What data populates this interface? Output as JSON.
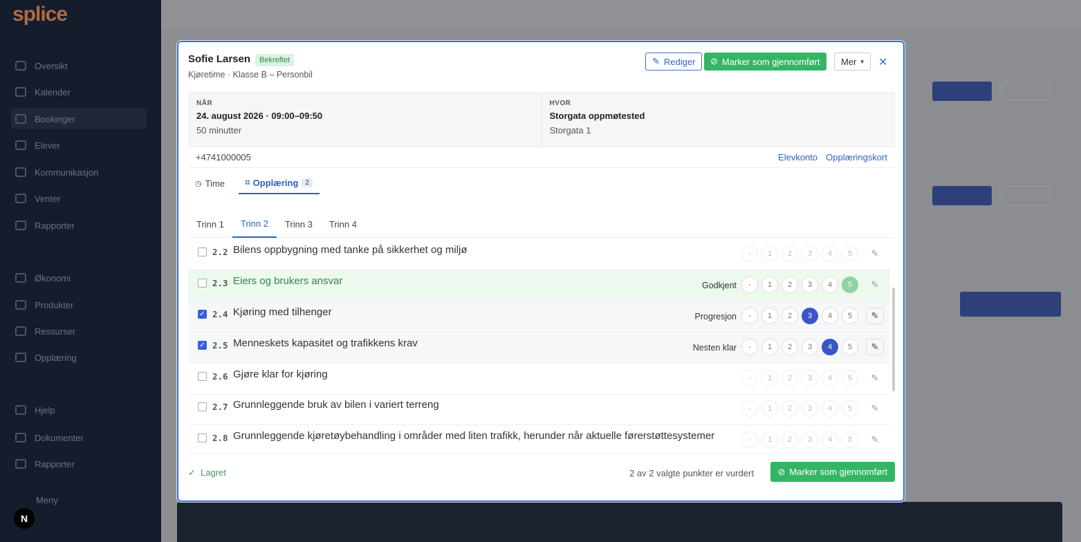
{
  "app": {
    "logo": "splice"
  },
  "sidebar": {
    "items": [
      {
        "label": "Oversikt"
      },
      {
        "label": "Kalender"
      },
      {
        "label": "Bookinger"
      },
      {
        "label": "Elever"
      },
      {
        "label": "Kommunikasjon"
      },
      {
        "label": "Venter"
      },
      {
        "label": "Rapporter"
      },
      {
        "label": "Økonomi"
      },
      {
        "label": "Produkter"
      },
      {
        "label": "Ressurser"
      },
      {
        "label": "Opplæring"
      },
      {
        "label": "Hjelp"
      },
      {
        "label": "Dokumenter"
      },
      {
        "label": "Rapporter"
      },
      {
        "label": "Meny"
      }
    ]
  },
  "modal": {
    "student_name": "Sofie Larsen",
    "status_badge": "Bekreftet",
    "subtitle": "Kjøretime · Klasse B – Personbil",
    "buttons": {
      "edit": "Rediger",
      "mark_done": "Marker som gjennomført",
      "more": "Mer"
    },
    "when": {
      "label": "NÅR",
      "value": "24. august 2026 · 09:00–09:50",
      "duration": "50 minutter"
    },
    "where": {
      "label": "HVOR",
      "value": "Storgata oppmøtested",
      "address": "Storgata 1"
    },
    "phone": "+4741000005",
    "links": {
      "account": "Elevkonto",
      "training_card": "Opplæringskort"
    },
    "tabs": [
      {
        "label": "Time"
      },
      {
        "label": "Opplæring",
        "count": "2"
      }
    ],
    "steps": [
      "Trinn 1",
      "Trinn 2",
      "Trinn 3",
      "Trinn 4"
    ],
    "rating_scale": [
      "-",
      "1",
      "2",
      "3",
      "4",
      "5"
    ],
    "items": [
      {
        "num": "2.2",
        "title": "Bilens oppbygning med tanke på sikkerhet og miljø",
        "status": "",
        "selected_score": null,
        "checked": false
      },
      {
        "num": "2.3",
        "title": "Eiers og brukers ansvar",
        "status": "Godkjent",
        "selected_score": "5",
        "checked": false
      },
      {
        "num": "2.4",
        "title": "Kjøring med tilhenger",
        "status": "Progresjon",
        "selected_score": "3",
        "checked": true
      },
      {
        "num": "2.5",
        "title": "Menneskets kapasitet og trafikkens krav",
        "status": "Nesten klar",
        "selected_score": "4",
        "checked": true
      },
      {
        "num": "2.6",
        "title": "Gjøre klar for kjøring",
        "status": "",
        "selected_score": null,
        "checked": false
      },
      {
        "num": "2.7",
        "title": "Grunnleggende bruk av bilen i variert terreng",
        "status": "",
        "selected_score": null,
        "checked": false
      },
      {
        "num": "2.8",
        "title": "Grunnleggende kjøretøybehandling i områder med liten trafikk, herunder når aktuelle førerstøttesystemer",
        "status": "",
        "selected_score": null,
        "checked": false
      }
    ],
    "footer": {
      "saved": "Lagret",
      "evaluated": "2 av 2 valgte punkter er vurdert",
      "mark_done": "Marker som gjennomført"
    }
  },
  "colors": {
    "primary": "#2f5fbf",
    "success": "#34b565",
    "selected": "#3b55c9"
  }
}
